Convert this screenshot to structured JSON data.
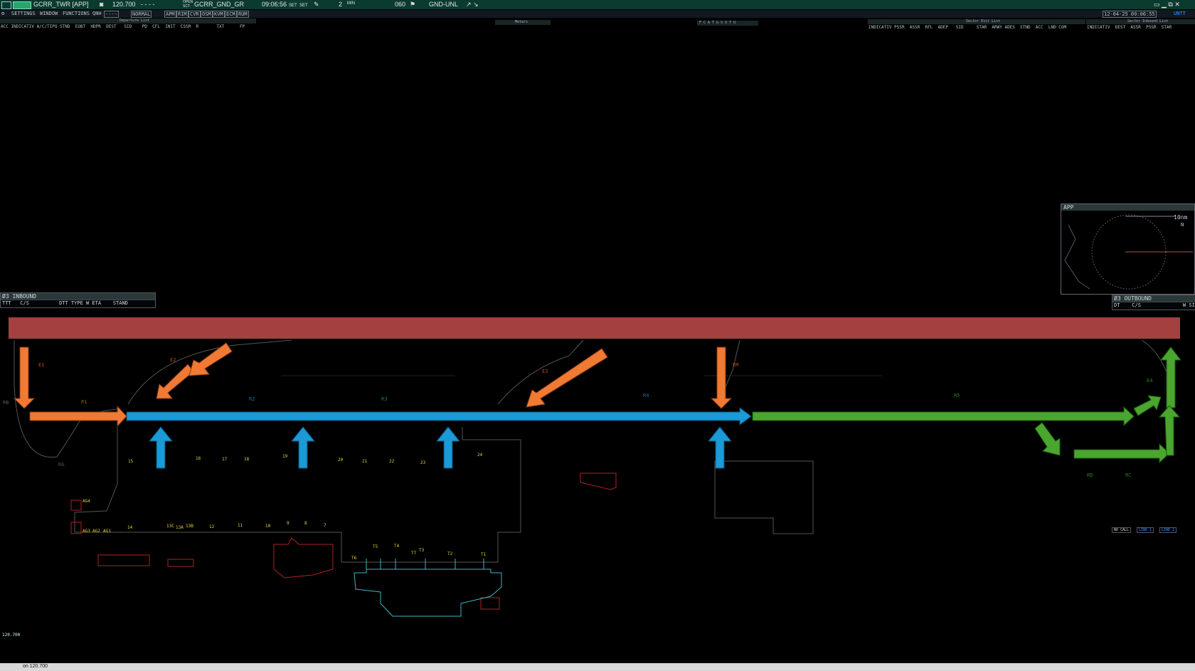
{
  "topbar": {
    "position": "GCRR_TWR [APP]",
    "frequency": "120.700",
    "freq_dashes": "-  -  -  -",
    "sector_prefix_1": "OPEN",
    "sector_prefix_2": "SCT",
    "sector": "GCRR_GND_GR",
    "time": "09:06:56",
    "set_1": "SET",
    "set_2": "SET",
    "count": "2",
    "min_label": "MIN",
    "heading": "060",
    "unl": "GND-UNL"
  },
  "menubar": {
    "settings": "SETTINGS",
    "window": "WINDOW",
    "functions": "FUNCTIONS",
    "qnh": "QNH",
    "qnh_value": "----",
    "mode": "NORMAL",
    "toggles": [
      "APM",
      "RIM",
      "CVR",
      "OSM",
      "KVM",
      "ECM",
      "RUM"
    ],
    "datetime": "12-04-25 09:06:55",
    "status": "UNTT"
  },
  "departure_list": {
    "title": "Departure List",
    "columns": "ACC INDICATIV A/C/TIPO STND  EOBT  HDPR  DEST   SID    PD  CFL  INIT  CSSR  R       TXT      FP"
  },
  "metars": {
    "title": "Metars"
  },
  "fps_panel": {
    "title": "F C A T G S O T U"
  },
  "sector_exit": {
    "title": "Sector Exit List",
    "columns": "INDICATIV PSSR  ASSR  RFL  ADEP   SID     STAR  ARWY ADES  STND  ACC  LND COM"
  },
  "sector_inbound": {
    "title": "Sector Inbound List",
    "columns": "INDICATIV  DEST  ASSR  PSSR  STAR"
  },
  "inbound": {
    "title": "Ø3 INBOUND",
    "columns": "TTT   C/S          DTT TYPE W ETA    STAND"
  },
  "outbound": {
    "title": "Ø3 OUTBOUND",
    "columns": "DT    C/S              W SID"
  },
  "app_window": {
    "title": "APP",
    "range": "10nm",
    "north": "N"
  },
  "map_labels": {
    "taxiways": [
      "E1",
      "E2",
      "E3",
      "EM",
      "E4",
      "R1",
      "R2",
      "R3",
      "R4",
      "R5",
      "RA",
      "RB",
      "RC",
      "RD"
    ],
    "stands": [
      "15",
      "16",
      "17",
      "18",
      "19",
      "20",
      "21",
      "22",
      "23",
      "24",
      "14",
      "13C",
      "13A",
      "13B",
      "12",
      "11",
      "10",
      "9",
      "8",
      "7",
      "AG4",
      "AG3",
      "AG2",
      "AG1"
    ],
    "terminal": [
      "T6",
      "T5",
      "T4",
      "T7",
      "T3",
      "T2",
      "T1"
    ]
  },
  "bottom": {
    "freq": "120.700",
    "status_line": "on 120.700"
  },
  "lines_widget": {
    "no_call": "NO CALL",
    "line1": "LINE 1",
    "line2": "LINE 2"
  },
  "colors": {
    "runway": "#a34141",
    "departure_arrows": "#f07a34",
    "taxi_arrows": "#1a9ad6",
    "exit_arrows": "#4aa62e",
    "topbar": "#0b3a2e"
  }
}
